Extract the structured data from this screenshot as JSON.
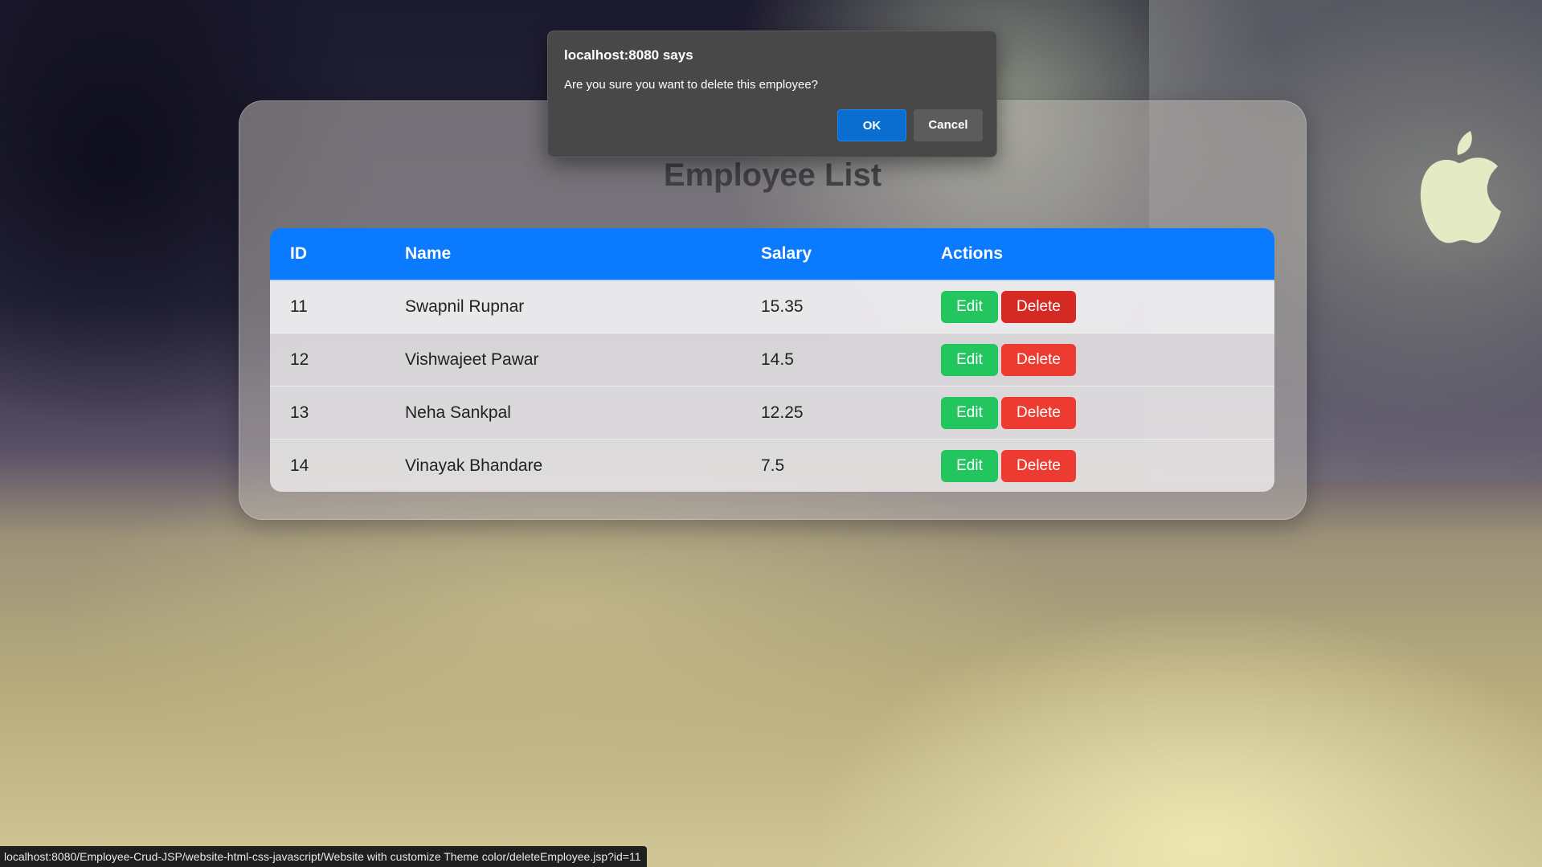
{
  "page": {
    "title": "Employee List"
  },
  "table": {
    "headers": [
      "ID",
      "Name",
      "Salary",
      "Actions"
    ],
    "rows": [
      {
        "id": "11",
        "name": "Swapnil Rupnar",
        "salary": "15.35"
      },
      {
        "id": "12",
        "name": "Vishwajeet Pawar",
        "salary": "14.5"
      },
      {
        "id": "13",
        "name": "Neha Sankpal",
        "salary": "12.25"
      },
      {
        "id": "14",
        "name": "Vinayak Bhandare",
        "salary": "7.5"
      }
    ],
    "edit_label": "Edit",
    "delete_label": "Delete"
  },
  "dialog": {
    "title": "localhost:8080 says",
    "message": "Are you sure you want to delete this employee?",
    "ok_label": "OK",
    "cancel_label": "Cancel"
  },
  "status_bar": {
    "url": "localhost:8080/Employee-Crud-JSP/website-html-css-javascript/Website with customize Theme color/deleteEmployee.jsp?id=11"
  },
  "colors": {
    "header_blue": "#0a7aff",
    "edit_green": "#22c55e",
    "delete_red": "#ee3b32",
    "dialog_ok_blue": "#0a6ed1"
  },
  "icons": {
    "background_logo": "apple-logo-icon"
  }
}
